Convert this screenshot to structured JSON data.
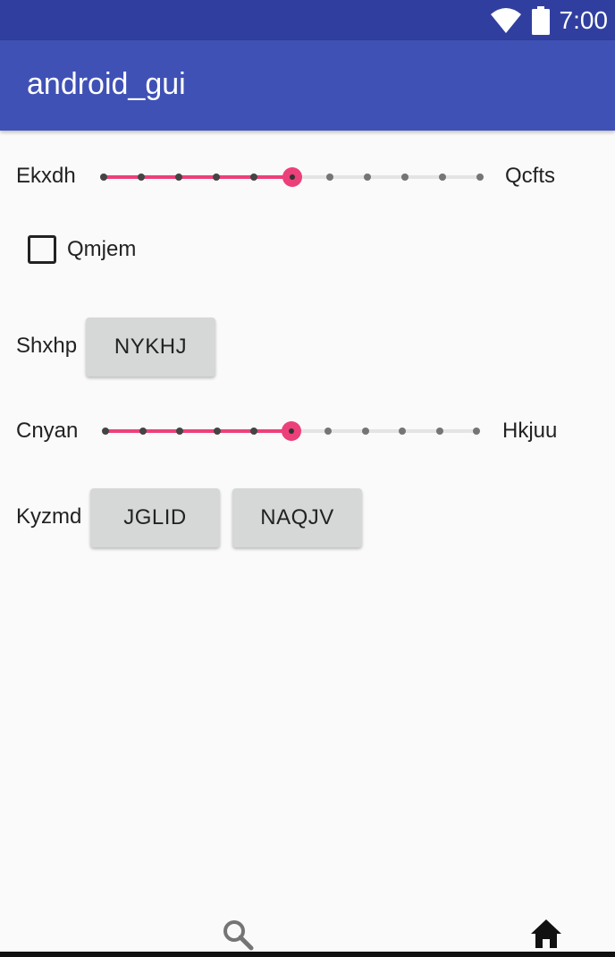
{
  "status_bar": {
    "time": "7:00",
    "icons": [
      "wifi-icon",
      "battery-icon"
    ],
    "color": "#303f9f"
  },
  "app_bar": {
    "title": "android_gui",
    "color": "#3f51b5"
  },
  "row1": {
    "left_label": "Ekxdh",
    "right_label": "Qcfts",
    "slider": {
      "value": 5,
      "max": 10
    }
  },
  "checkbox": {
    "label": "Qmjem",
    "checked": false
  },
  "row3": {
    "label": "Shxhp",
    "button": "NYKHJ"
  },
  "row4": {
    "left_label": "Cnyan",
    "right_label": "Hkjuu",
    "slider": {
      "value": 5,
      "max": 10
    }
  },
  "row5": {
    "label": "Kyzmd",
    "button1": "JGLID",
    "button2": "NAQJV"
  },
  "bottom_nav": {
    "icons": [
      "search-icon",
      "home-icon"
    ]
  },
  "accent_color": "#ec407a"
}
